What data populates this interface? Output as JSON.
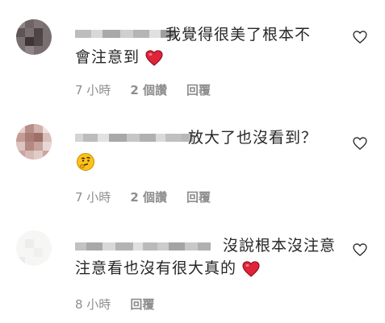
{
  "comments": [
    {
      "text_line1": "我覺得很美了根本不",
      "text_line2": "會注意到",
      "time": "7 小時",
      "likes": "2 個讚",
      "reply": "回覆",
      "emoji": "red-heart"
    },
    {
      "text_line1": "放大了也沒看到？",
      "time": "7 小時",
      "likes": "2 個讚",
      "reply": "回覆",
      "emoji": "thinking-face"
    },
    {
      "text_line1": "沒說根本沒注意",
      "text_line2": "注意看也沒有很大真的",
      "time": "8 小時",
      "reply": "回覆",
      "emoji": "red-heart"
    }
  ],
  "colors": {
    "text": "#262626",
    "meta": "#8e8e8e",
    "heart": "#e0243a"
  },
  "icons": [
    "heart-outline-icon",
    "red-heart-emoji",
    "thinking-face-emoji"
  ]
}
